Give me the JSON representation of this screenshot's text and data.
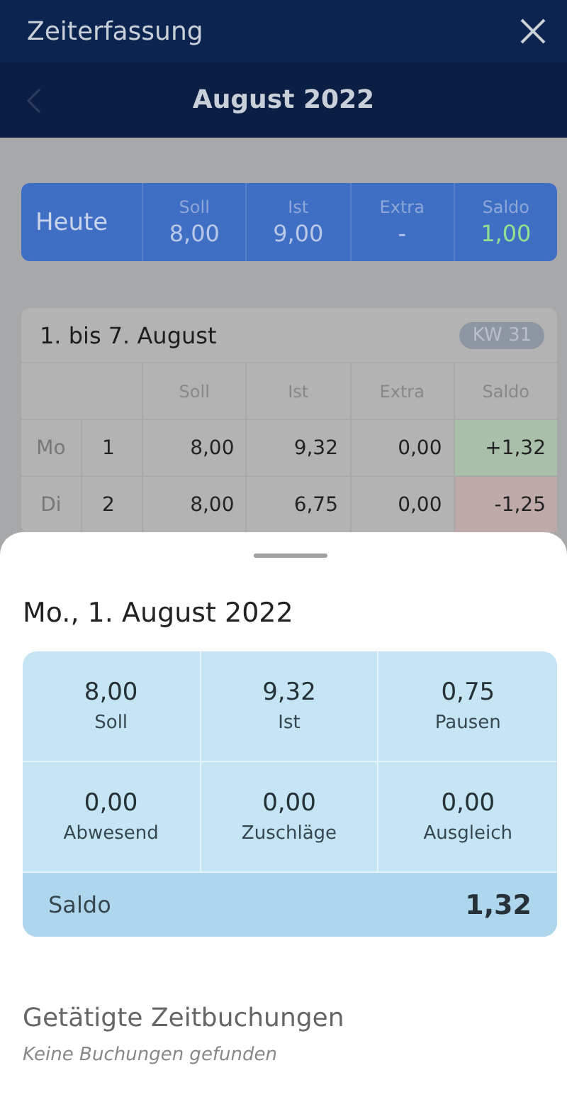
{
  "app_bar": {
    "title": "Zeiterfassung"
  },
  "month_nav": {
    "title": "August 2022",
    "prev_disabled": true
  },
  "today": {
    "label": "Heute",
    "columns": [
      {
        "heading": "Soll",
        "value": "8,00",
        "color": "#b9c8e6"
      },
      {
        "heading": "Ist",
        "value": "9,00",
        "color": "#b9c8e6"
      },
      {
        "heading": "Extra",
        "value": "-",
        "color": "#b9c8e6"
      },
      {
        "heading": "Saldo",
        "value": "1,00",
        "color": "#8fe08f"
      }
    ]
  },
  "week": {
    "title": "1. bis 7. August",
    "badge": "KW 31",
    "columns": [
      "Soll",
      "Ist",
      "Extra",
      "Saldo"
    ],
    "rows": [
      {
        "weekday": "Mo",
        "day": "1",
        "soll": "8,00",
        "ist": "9,32",
        "extra": "0,00",
        "saldo": "+1,32",
        "color": "#a9bfa9"
      },
      {
        "weekday": "Di",
        "day": "2",
        "soll": "8,00",
        "ist": "6,75",
        "extra": "0,00",
        "saldo": "-1,25",
        "color": "#bfa9a9"
      }
    ]
  },
  "sheet": {
    "title": "Mo., 1. August 2022",
    "stats": [
      {
        "value": "8,00",
        "label": "Soll"
      },
      {
        "value": "9,32",
        "label": "Ist"
      },
      {
        "value": "0,75",
        "label": "Pausen"
      },
      {
        "value": "0,00",
        "label": "Abwesend"
      },
      {
        "value": "0,00",
        "label": "Zuschläge"
      },
      {
        "value": "0,00",
        "label": "Ausgleich"
      }
    ],
    "saldo": {
      "label": "Saldo",
      "value": "1,32"
    },
    "bookings_title": "Getätigte Zeitbuchungen",
    "bookings_empty": "Keine Buchungen gefunden"
  }
}
